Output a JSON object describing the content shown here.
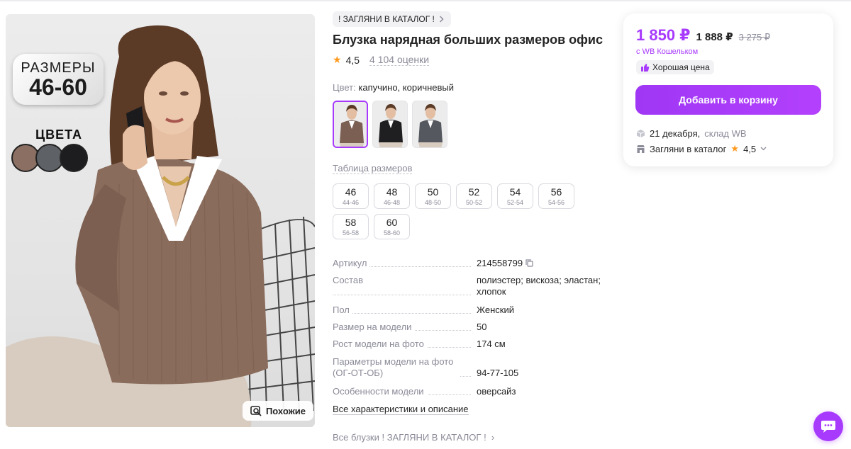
{
  "photo": {
    "badge_line1": "РАЗМЕРЫ",
    "badge_line2": "46-60",
    "colors_title": "ЦВЕТА",
    "swatches": [
      "#8a6f62",
      "#5e6166",
      "#1d1d20"
    ],
    "similar_label": "Похожие"
  },
  "product": {
    "brand": "! ЗАГЛЯНИ В КАТАЛОГ !",
    "title": "Блузка нарядная больших размеров офис",
    "rating": "4,5",
    "reviews": "4 104 оценки",
    "color_label": "Цвет:",
    "color_value": "капучино, коричневый",
    "variant_colors": [
      "#7a5f52",
      "#1f1f22",
      "#55585e"
    ],
    "size_table_label": "Таблица размеров",
    "sizes": [
      {
        "size": "46",
        "ru": "44-46"
      },
      {
        "size": "48",
        "ru": "46-48"
      },
      {
        "size": "50",
        "ru": "48-50"
      },
      {
        "size": "52",
        "ru": "50-52"
      },
      {
        "size": "54",
        "ru": "52-54"
      },
      {
        "size": "56",
        "ru": "54-56"
      },
      {
        "size": "58",
        "ru": "56-58"
      },
      {
        "size": "60",
        "ru": "58-60"
      }
    ],
    "specs": [
      {
        "key": "Артикул",
        "value": "214558799"
      },
      {
        "key": "Состав",
        "value": "полиэстер; вискоза; эластан; хлопок"
      },
      {
        "key": "Пол",
        "value": "Женский"
      },
      {
        "key": "Размер на модели",
        "value": "50"
      },
      {
        "key": "Рост модели на фото",
        "value": "174 см"
      },
      {
        "key": "Параметры модели на фото (ОГ-ОТ-ОБ)",
        "value": "94-77-105"
      },
      {
        "key": "Особенности модели",
        "value": "оверсайз"
      }
    ],
    "all_specs_label": "Все характеристики и описание",
    "breadcrumb": "Все блузки ! ЗАГЛЯНИ В КАТАЛОГ !"
  },
  "buy": {
    "price": "1 850 ₽",
    "price_secondary": "1 888 ₽",
    "price_old": "3 275 ₽",
    "wallet_note": "с WB Кошельком",
    "good_price": "Хорошая цена",
    "add_to_cart": "Добавить в корзину",
    "delivery_date": "21 декабря,",
    "delivery_wh": "склад WB",
    "seller": "Загляни в каталог",
    "seller_rating": "4,5"
  },
  "colors": {
    "accent": "#a73afd",
    "star": "#ff9a1f",
    "muted": "#8b8b99"
  }
}
